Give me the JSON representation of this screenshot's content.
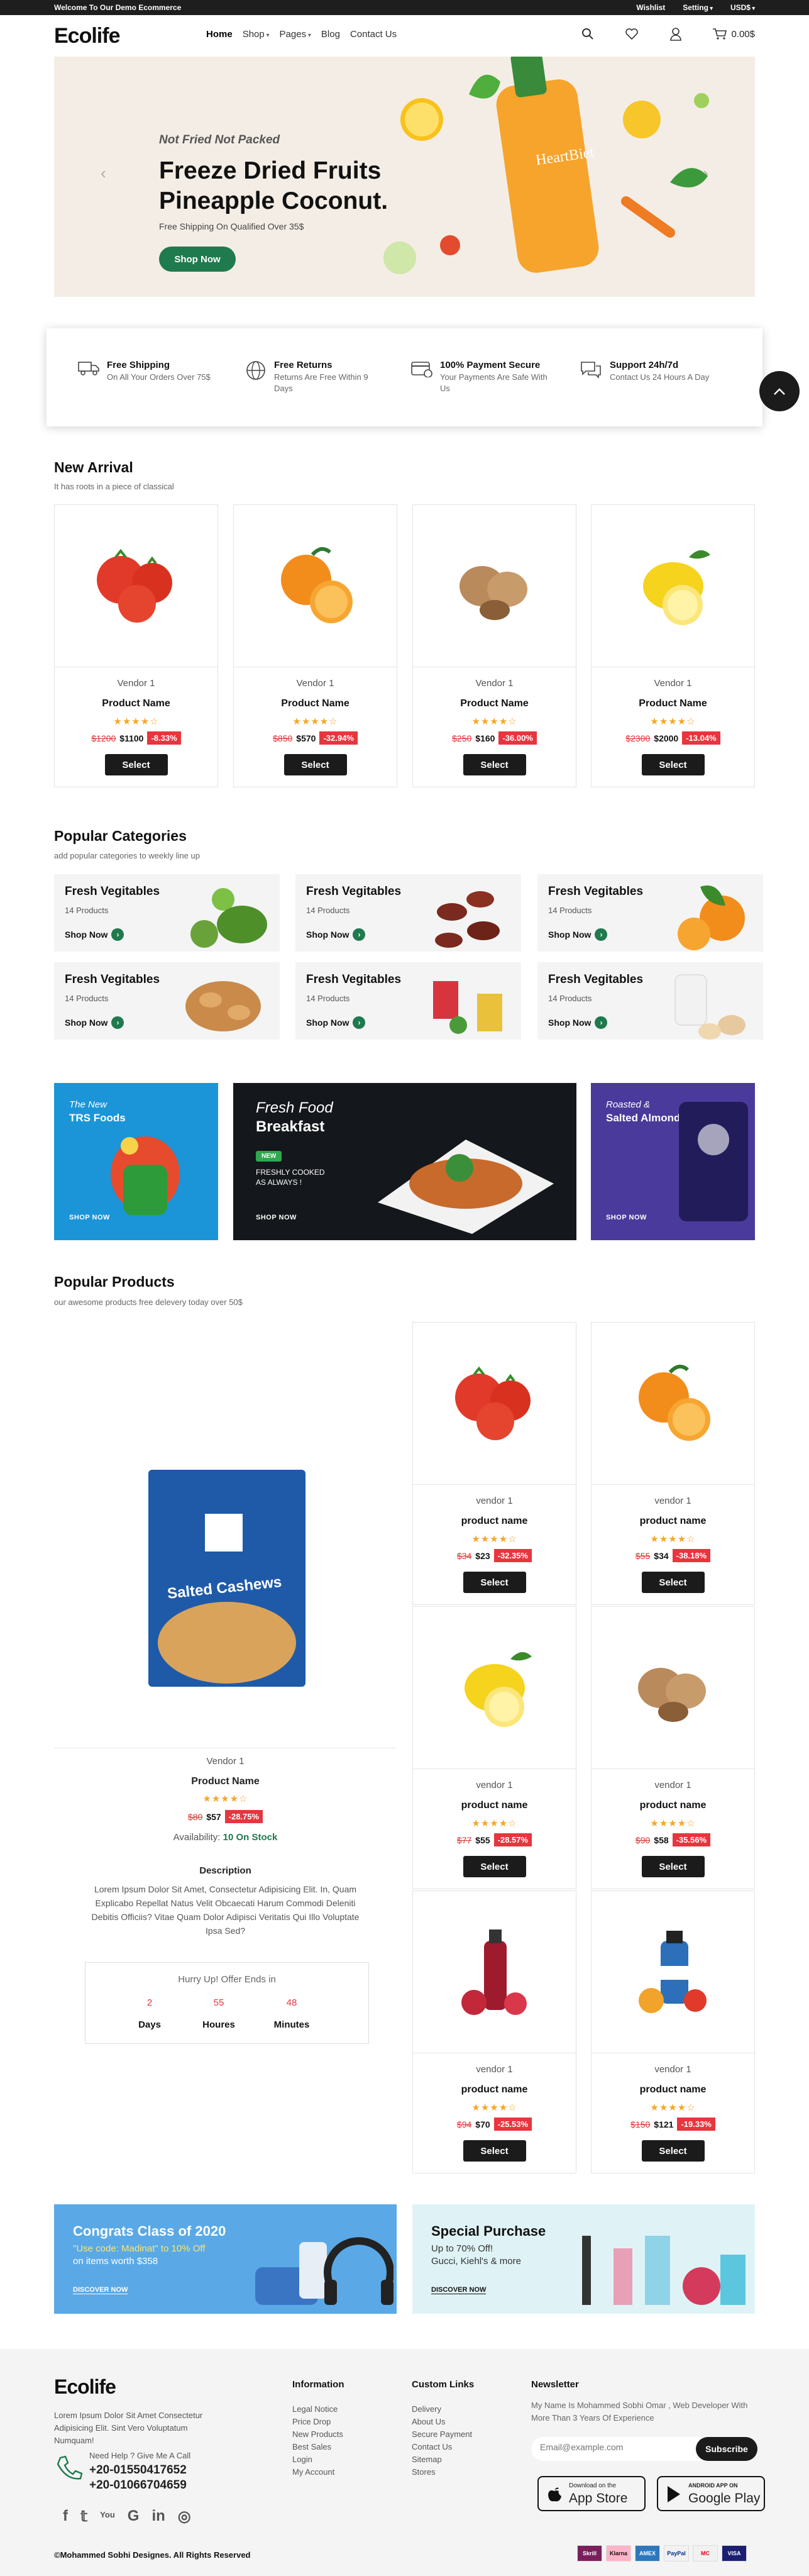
{
  "topbar": {
    "welcome": "Welcome To Our Demo Ecommerce",
    "wishlist": "Wishlist",
    "setting": "Setting",
    "currency": "USD$"
  },
  "header": {
    "logo": "Ecolife",
    "nav": [
      "Home",
      "Shop",
      "Pages",
      "Blog",
      "Contact Us"
    ],
    "cart_total": "0.00$"
  },
  "hero": {
    "subtitle": "Not Fried Not Packed",
    "title": "Freeze Dried Fruits Pineapple Coconut.",
    "shipping": "Free Shipping On Qualified Over 35$",
    "button": "Shop Now",
    "bottle_label": "HeartBiet"
  },
  "features": [
    {
      "title": "Free Shipping",
      "desc": "On All Your Orders Over 75$",
      "icon": "truck-icon"
    },
    {
      "title": "Free Returns",
      "desc": "Returns Are Free Within 9 Days",
      "icon": "globe-icon"
    },
    {
      "title": "100% Payment Secure",
      "desc": "Your Payments Are Safe With Us",
      "icon": "card-icon"
    },
    {
      "title": "Support 24h/7d",
      "desc": "Contact Us 24 Hours A Day",
      "icon": "chat-icon"
    }
  ],
  "new_arrival": {
    "title": "New Arrival",
    "subtitle": "It has roots in a piece of classical",
    "products": [
      {
        "vendor": "Vendor 1",
        "name": "Product Name",
        "old": "$1200",
        "new": "$1100",
        "disc": "-8.33%",
        "img": "tomato"
      },
      {
        "vendor": "Vendor 1",
        "name": "Product Name",
        "old": "$850",
        "new": "$570",
        "disc": "-32.94%",
        "img": "orange"
      },
      {
        "vendor": "Vendor 1",
        "name": "Product Name",
        "old": "$250",
        "new": "$160",
        "disc": "-36.00%",
        "img": "walnut"
      },
      {
        "vendor": "Vendor 1",
        "name": "Product Name",
        "old": "$2300",
        "new": "$2000",
        "disc": "-13.04%",
        "img": "lemon"
      }
    ],
    "select": "Select"
  },
  "categories": {
    "title": "Popular Categories",
    "subtitle": "add popular categories to weekly line up",
    "items": [
      {
        "name": "Fresh Vegitables",
        "count": "14 Products",
        "shop": "Shop Now"
      },
      {
        "name": "Fresh Vegitables",
        "count": "14 Products",
        "shop": "Shop Now"
      },
      {
        "name": "Fresh Vegitables",
        "count": "14 Products",
        "shop": "Shop Now"
      },
      {
        "name": "Fresh Vegitables",
        "count": "14 Products",
        "shop": "Shop Now"
      },
      {
        "name": "Fresh Vegitables",
        "count": "14 Products",
        "shop": "Shop Now"
      },
      {
        "name": "Fresh Vegitables",
        "count": "14 Products",
        "shop": "Shop Now"
      }
    ]
  },
  "banners": [
    {
      "line1": "The New",
      "line2": "TRS Foods",
      "shop": "SHOP NOW"
    },
    {
      "line1": "Fresh Food",
      "line2": "Breakfast",
      "badge": "NEW",
      "tag": "FRESHLY COOKED AS ALWAYS !",
      "shop": "SHOP NOW"
    },
    {
      "line1": "Roasted &",
      "line2": "Salted Almonds",
      "shop": "SHOP NOW"
    }
  ],
  "popular": {
    "title": "Popular Products",
    "subtitle": "our awesome products free delevery today over 50$",
    "featured": {
      "package_label": "Salted Cashews",
      "vendor": "Vendor 1",
      "name": "Product Name",
      "old": "$80",
      "new": "$57",
      "disc": "-28.75%",
      "availability_label": "Availability:",
      "availability": "10 On Stock",
      "desc_title": "Description",
      "desc": "Lorem Ipsum Dolor Sit Amet, Consectetur Adipisicing Elit. In, Quam Explicabo Repellat Natus Velit Obcaecati Harum Commodi Deleniti Debitis Officiis? Vitae Quam Dolor Adipisci Veritatis Qui Illo Voluptate Ipsa Sed?",
      "timer_title": "Hurry Up! Offer Ends in",
      "timer": [
        {
          "v": "2",
          "l": "Days"
        },
        {
          "v": "55",
          "l": "Houres"
        },
        {
          "v": "48",
          "l": "Minutes"
        }
      ]
    },
    "grid": [
      {
        "vendor": "vendor 1",
        "name": "product name",
        "old": "$34",
        "new": "$23",
        "disc": "-32.35%",
        "img": "tomato"
      },
      {
        "vendor": "vendor 1",
        "name": "product name",
        "old": "$55",
        "new": "$34",
        "disc": "-38.18%",
        "img": "orange"
      },
      {
        "vendor": "vendor 1",
        "name": "product name",
        "old": "$77",
        "new": "$55",
        "disc": "-28.57%",
        "img": "lemon"
      },
      {
        "vendor": "vendor 1",
        "name": "product name",
        "old": "$90",
        "new": "$58",
        "disc": "-35.56%",
        "img": "walnut"
      },
      {
        "vendor": "vendor 1",
        "name": "product name",
        "old": "$94",
        "new": "$70",
        "disc": "-25.53%",
        "img": "juice"
      },
      {
        "vendor": "vendor 1",
        "name": "product name",
        "old": "$150",
        "new": "$121",
        "disc": "-19.33%",
        "img": "bottle"
      }
    ],
    "select": "Select"
  },
  "promos": [
    {
      "title": "Congrats Class of 2020",
      "line1": "\"Use code: Madinat\" to 10% Off",
      "line2": "on items worth $358",
      "shop": "DISCOVER NOW"
    },
    {
      "title": "Special Purchase",
      "line1": "Up to 70% Off!",
      "line2": "Gucci, Kiehl's & more",
      "shop": "DISCOVER NOW"
    }
  ],
  "footer": {
    "logo": "Ecolife",
    "about": "Lorem Ipsum Dolor Sit Amet Consectetur Adipisicing Elit. Sint Vero Voluptatum Numquam!",
    "help": "Need Help ? Give Me A Call",
    "phone1": "+20-01550417652",
    "phone2": "+20-01066704659",
    "info_title": "Information",
    "info": [
      "Legal Notice",
      "Price Drop",
      "New Products",
      "Best Sales",
      "Login",
      "My Account"
    ],
    "links_title": "Custom Links",
    "links": [
      "Delivery",
      "About Us",
      "Secure Payment",
      "Contact Us",
      "Sitemap",
      "Stores"
    ],
    "news_title": "Newsletter",
    "news_text": "My Name Is Mohammed Sobhi Omar , Web Developer With More Than 3 Years Of Experience",
    "email_placeholder": "Email@example.com",
    "subscribe": "Subscribe",
    "appstore_small": "Download on the",
    "appstore": "App Store",
    "gplay_small": "ANDROID APP ON",
    "gplay": "Google Play",
    "copyright": "©Mohammed Sobhi Designes. All Rights Reserved",
    "payments": [
      "Skrill",
      "Klarna",
      "AMEX",
      "PayPal",
      "MC",
      "VISA"
    ]
  }
}
